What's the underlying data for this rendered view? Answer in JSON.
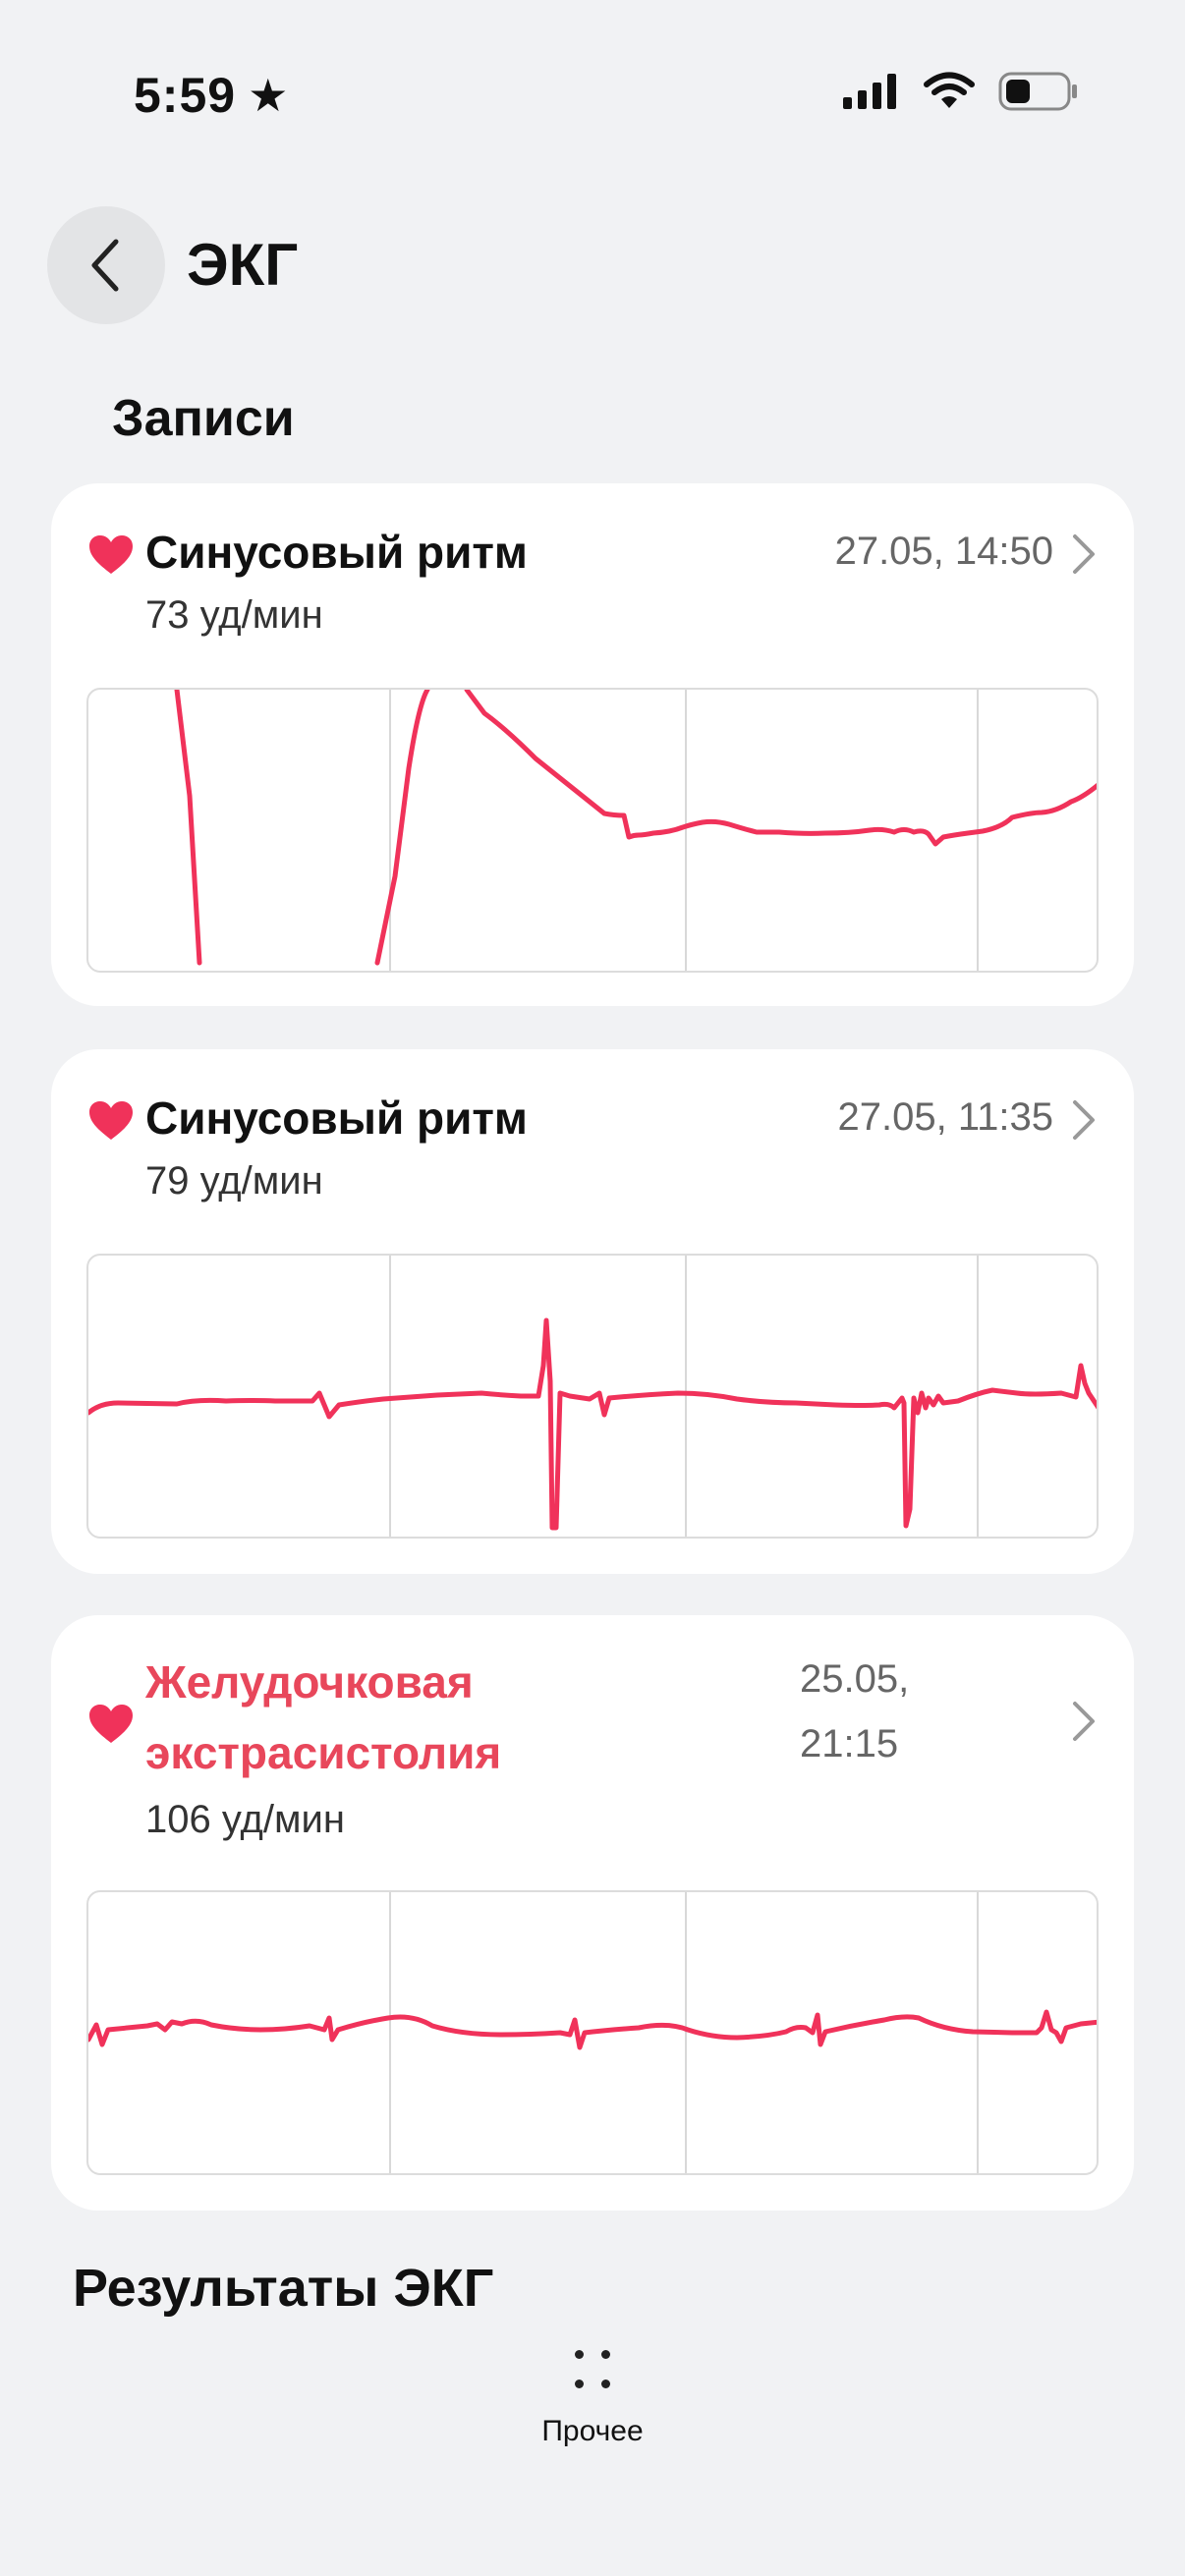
{
  "status_bar": {
    "time": "5:59",
    "star_glyph": "★",
    "icons": [
      "signal-icon",
      "wifi-icon",
      "battery-icon"
    ]
  },
  "header": {
    "back_icon": "chevron-left-icon",
    "title": "ЭКГ"
  },
  "records_section": {
    "title": "Записи",
    "items": [
      {
        "status": "Синусовый ритм",
        "heart_rate": "73 уд/мин",
        "date": "27.05, 14:50",
        "alert": false
      },
      {
        "status": "Синусовый ритм",
        "heart_rate": "79 уд/мин",
        "date": "27.05, 11:35",
        "alert": false
      },
      {
        "status": "Желудочковая экстрасистолия",
        "heart_rate": "106 уд/мин",
        "date": "25.05, 21:15",
        "alert": true
      }
    ]
  },
  "results_section": {
    "title": "Результаты ЭКГ"
  },
  "bottom": {
    "other_label": "Прочее",
    "other_icon": "dots-grid-icon"
  },
  "colors": {
    "accent": "#f0325a",
    "alert_text": "#e8475b",
    "background": "#f1f2f4",
    "card": "#ffffff"
  }
}
